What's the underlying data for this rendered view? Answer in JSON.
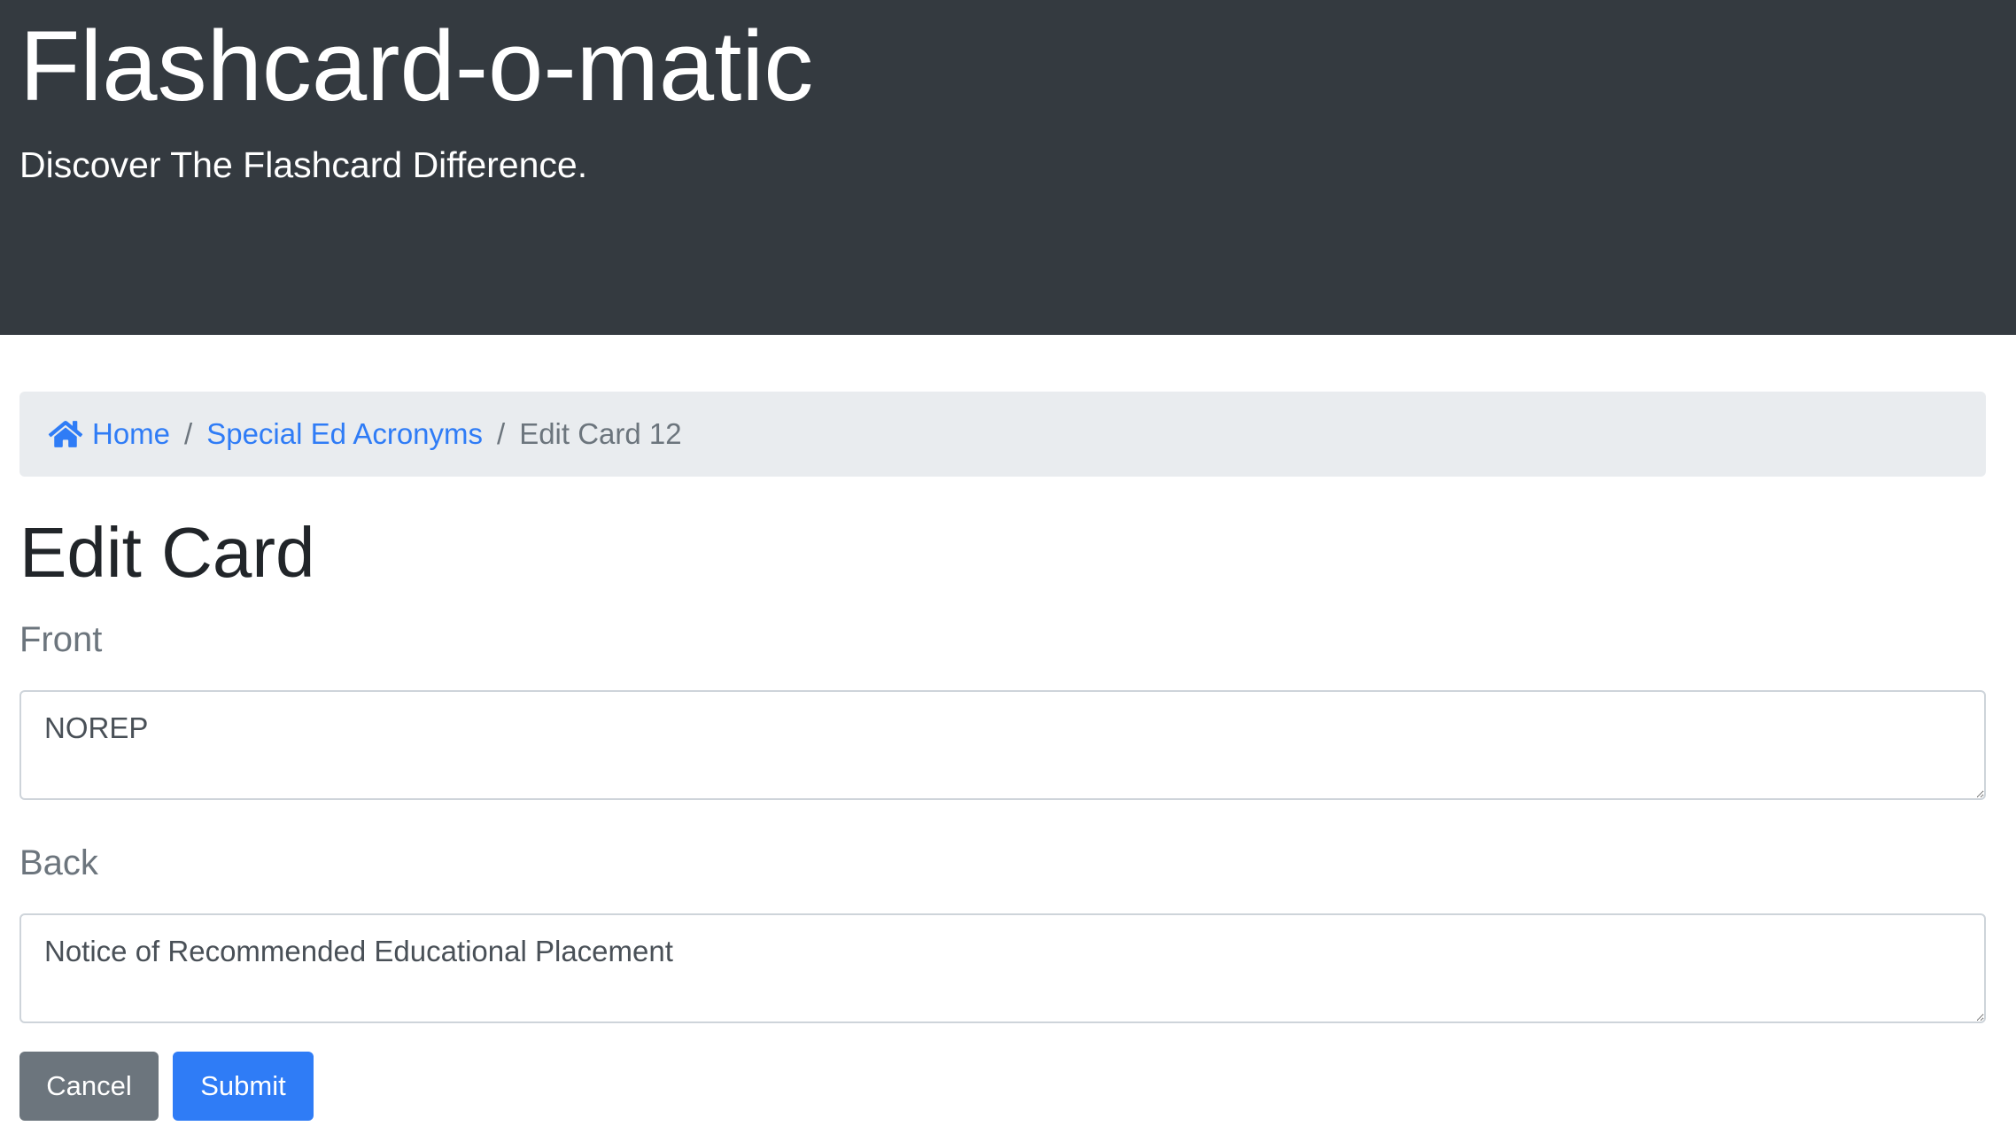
{
  "header": {
    "title": "Flashcard-o-matic",
    "subtitle": "Discover The Flashcard Difference."
  },
  "breadcrumb": {
    "home_icon": "home-icon",
    "home_label": "Home",
    "separator": "/",
    "deck_label": "Special Ed Acronyms",
    "current_label": "Edit Card 12"
  },
  "main": {
    "title": "Edit Card",
    "front": {
      "label": "Front",
      "value": "NOREP"
    },
    "back": {
      "label": "Back",
      "value": "Notice of Recommended Educational Placement"
    },
    "cancel_label": "Cancel",
    "submit_label": "Submit"
  },
  "colors": {
    "header_bg": "#343a40",
    "link": "#2f7cf6",
    "breadcrumb_bg": "#e9ecef",
    "cancel_bg": "#6c757d",
    "submit_bg": "#2f7cf6"
  }
}
